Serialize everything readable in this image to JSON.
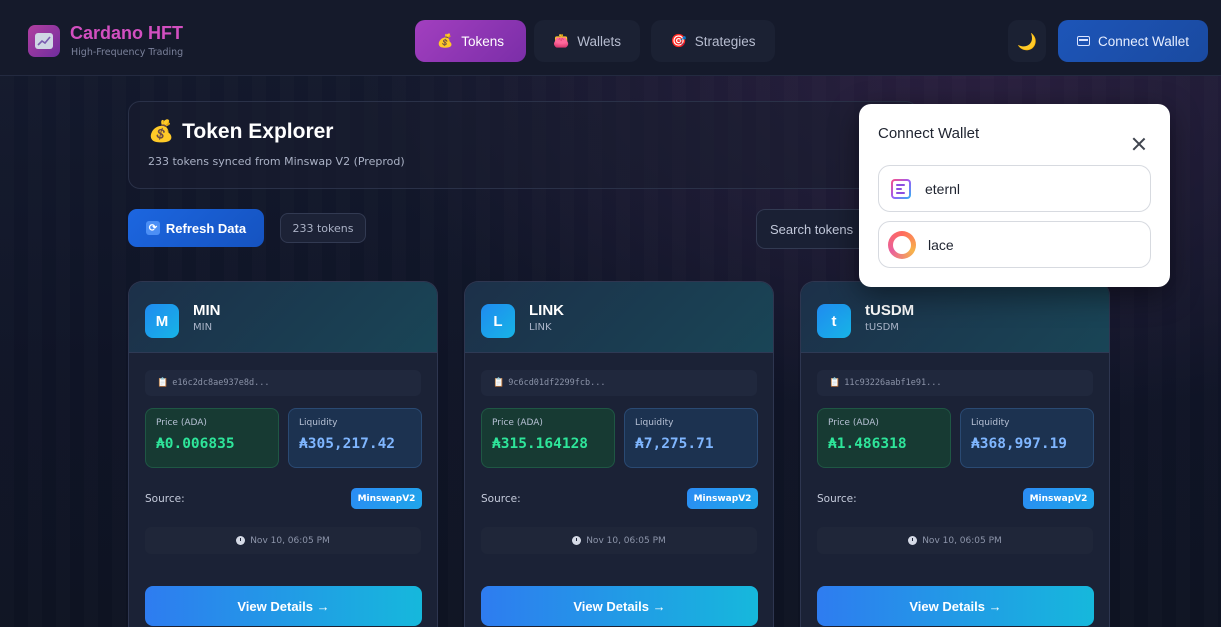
{
  "brand": {
    "title": "Cardano HFT",
    "subtitle": "High-Frequency Trading"
  },
  "nav": {
    "tabs": [
      {
        "label": "Tokens",
        "icon": "money-bag-icon",
        "active": true
      },
      {
        "label": "Wallets",
        "icon": "purse-icon",
        "active": false
      },
      {
        "label": "Strategies",
        "icon": "target-icon",
        "active": false
      }
    ],
    "theme_icon": "moon-icon",
    "connect_label": "Connect Wallet"
  },
  "header": {
    "title": "Token Explorer",
    "subtitle": "233 tokens synced from Minswap V2 (Preprod)"
  },
  "actions": {
    "refresh_label": "Refresh Data",
    "count_label": "233 tokens",
    "search_placeholder": "Search tokens"
  },
  "tokens": [
    {
      "initial": "M",
      "name": "MIN",
      "symbol": "MIN",
      "address": "e16c2dc8ae937e8d...",
      "price_label": "Price (ADA)",
      "price": "₳0.006835",
      "liquidity_label": "Liquidity",
      "liquidity": "₳305,217.42",
      "source_label": "Source:",
      "source": "MinswapV2",
      "updated": "Nov 10, 06:05 PM",
      "details_label": "View Details →"
    },
    {
      "initial": "L",
      "name": "LINK",
      "symbol": "LINK",
      "address": "9c6cd01df2299fcb...",
      "price_label": "Price (ADA)",
      "price": "₳315.164128",
      "liquidity_label": "Liquidity",
      "liquidity": "₳7,275.71",
      "source_label": "Source:",
      "source": "MinswapV2",
      "updated": "Nov 10, 06:05 PM",
      "details_label": "View Details →"
    },
    {
      "initial": "t",
      "name": "tUSDM",
      "symbol": "tUSDM",
      "address": "11c93226aabf1e91...",
      "price_label": "Price (ADA)",
      "price": "₳1.486318",
      "liquidity_label": "Liquidity",
      "liquidity": "₳368,997.19",
      "source_label": "Source:",
      "source": "MinswapV2",
      "updated": "Nov 10, 06:05 PM",
      "details_label": "View Details →"
    }
  ],
  "modal": {
    "title": "Connect Wallet",
    "wallets": [
      {
        "name": "eternl",
        "icon": "eternl-logo-icon"
      },
      {
        "name": "lace",
        "icon": "lace-logo-icon"
      }
    ]
  },
  "colors": {
    "accent_purple": "#a23fbf",
    "accent_blue": "#1c66e0",
    "price_green": "#2ee59a",
    "liquidity_blue": "#7fb6ff",
    "brand_pink": "#d24fc0"
  }
}
